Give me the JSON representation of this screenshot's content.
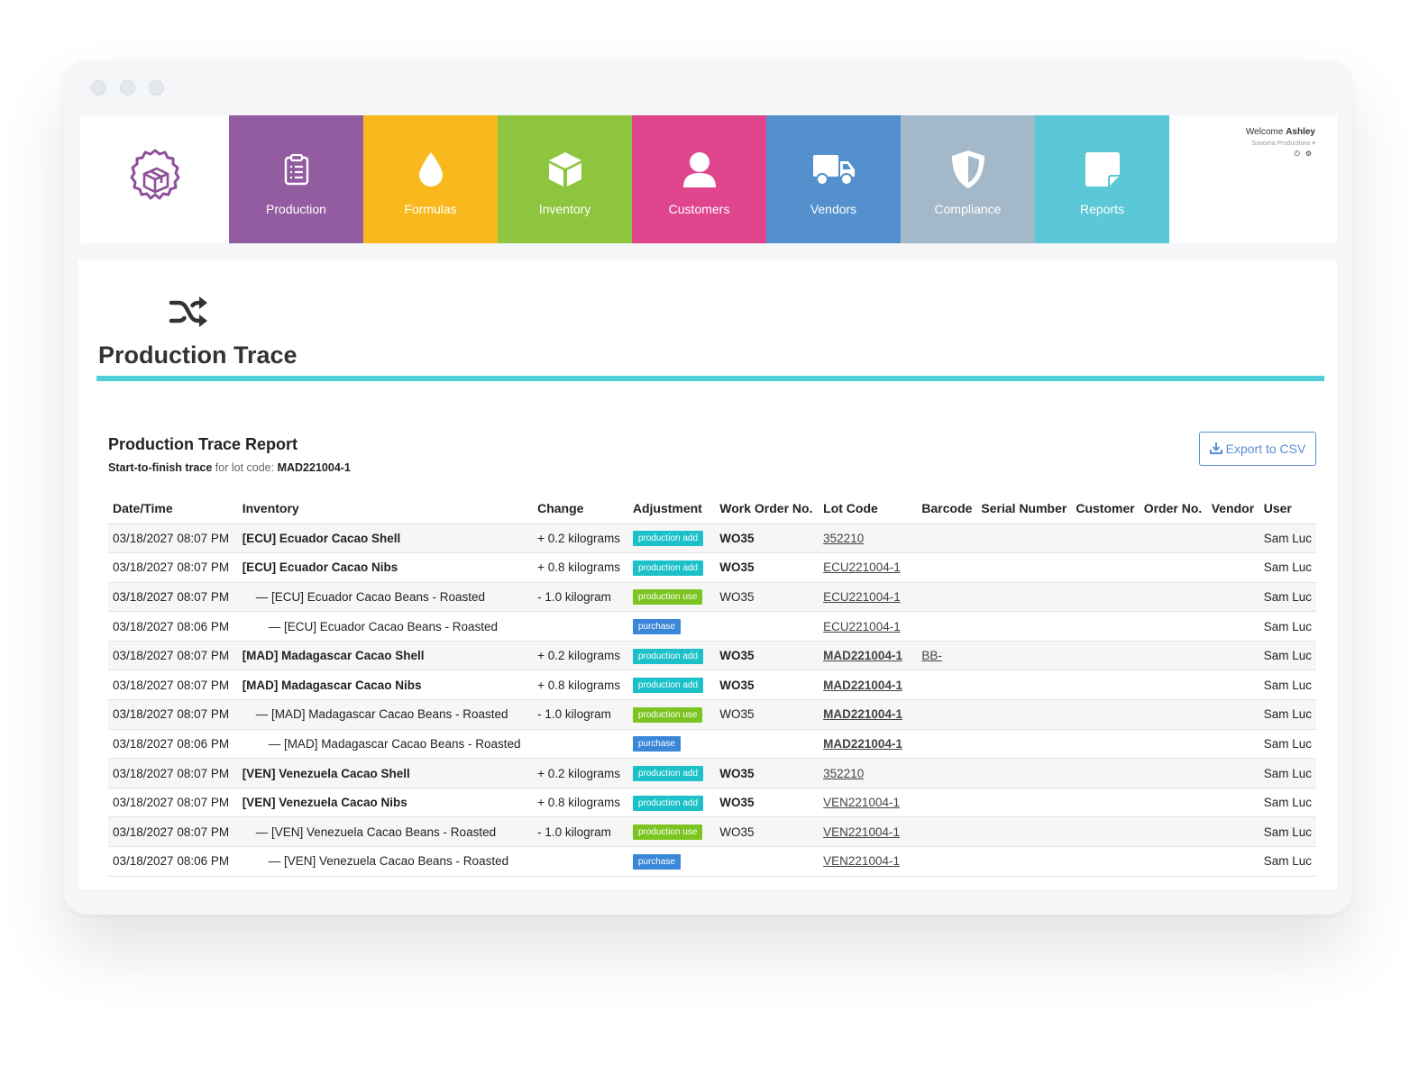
{
  "nav": {
    "tiles": [
      {
        "label": "Production",
        "color": "#935ba0"
      },
      {
        "label": "Formulas",
        "color": "#f9b91c"
      },
      {
        "label": "Inventory",
        "color": "#8dc53e"
      },
      {
        "label": "Customers",
        "color": "#de458d"
      },
      {
        "label": "Vendors",
        "color": "#5490cd"
      },
      {
        "label": "Compliance",
        "color": "#a3b8c9"
      },
      {
        "label": "Reports",
        "color": "#5ac8d6"
      }
    ],
    "welcome_prefix": "Welcome",
    "user_name": "Ashley",
    "company": "Sonoma Productions",
    "logo_color": "#8e4e9a"
  },
  "page": {
    "title": "Production Trace"
  },
  "report": {
    "title": "Production Trace Report",
    "subtitle_bold": "Start-to-finish trace",
    "subtitle_text": "for lot code:",
    "lot_code": "MAD221004-1",
    "export_label": "Export to CSV"
  },
  "table": {
    "headers": [
      "Date/Time",
      "Inventory",
      "Change",
      "Adjustment",
      "Work Order No.",
      "Lot Code",
      "Barcode",
      "Serial Number",
      "Customer",
      "Order No.",
      "Vendor",
      "User"
    ],
    "rows": [
      {
        "datetime": "03/18/2027 08:07 PM",
        "inventory": "[ECU] Ecuador Cacao Shell",
        "level": 0,
        "change": "+ 0.2 kilograms",
        "adjustment": "production add",
        "work_order": "WO35",
        "wo_bold": true,
        "lot_code": "352210",
        "lot_bold": false,
        "barcode": "",
        "serial": "",
        "customer": "",
        "order_no": "",
        "vendor": "",
        "user": "Sam Luc"
      },
      {
        "datetime": "03/18/2027 08:07 PM",
        "inventory": "[ECU] Ecuador Cacao Nibs",
        "level": 0,
        "change": "+ 0.8 kilograms",
        "adjustment": "production add",
        "work_order": "WO35",
        "wo_bold": true,
        "lot_code": "ECU221004-1",
        "lot_bold": false,
        "barcode": "",
        "serial": "",
        "customer": "",
        "order_no": "",
        "vendor": "",
        "user": "Sam Luc"
      },
      {
        "datetime": "03/18/2027 08:07 PM",
        "inventory": "— [ECU] Ecuador Cacao Beans - Roasted",
        "level": 1,
        "change": "- 1.0 kilogram",
        "adjustment": "production use",
        "work_order": "WO35",
        "wo_bold": false,
        "lot_code": "ECU221004-1",
        "lot_bold": false,
        "barcode": "",
        "serial": "",
        "customer": "",
        "order_no": "",
        "vendor": "",
        "user": "Sam Luc"
      },
      {
        "datetime": "03/18/2027 08:06 PM",
        "inventory": "— [ECU] Ecuador Cacao Beans - Roasted",
        "level": 2,
        "change": "",
        "adjustment": "purchase",
        "work_order": "",
        "wo_bold": false,
        "lot_code": "ECU221004-1",
        "lot_bold": false,
        "barcode": "",
        "serial": "",
        "customer": "",
        "order_no": "",
        "vendor": "",
        "user": "Sam Luc"
      },
      {
        "datetime": "03/18/2027 08:07 PM",
        "inventory": "[MAD] Madagascar Cacao Shell",
        "level": 0,
        "change": "+ 0.2 kilograms",
        "adjustment": "production add",
        "work_order": "WO35",
        "wo_bold": true,
        "lot_code": "MAD221004-1",
        "lot_bold": true,
        "barcode": "BB-",
        "serial": "",
        "customer": "",
        "order_no": "",
        "vendor": "",
        "user": "Sam Luc"
      },
      {
        "datetime": "03/18/2027 08:07 PM",
        "inventory": "[MAD] Madagascar Cacao Nibs",
        "level": 0,
        "change": "+ 0.8 kilograms",
        "adjustment": "production add",
        "work_order": "WO35",
        "wo_bold": true,
        "lot_code": "MAD221004-1",
        "lot_bold": true,
        "barcode": "",
        "serial": "",
        "customer": "",
        "order_no": "",
        "vendor": "",
        "user": "Sam Luc"
      },
      {
        "datetime": "03/18/2027 08:07 PM",
        "inventory": "— [MAD] Madagascar Cacao Beans - Roasted",
        "level": 1,
        "change": "- 1.0 kilogram",
        "adjustment": "production use",
        "work_order": "WO35",
        "wo_bold": false,
        "lot_code": "MAD221004-1",
        "lot_bold": true,
        "barcode": "",
        "serial": "",
        "customer": "",
        "order_no": "",
        "vendor": "",
        "user": "Sam Luc"
      },
      {
        "datetime": "03/18/2027 08:06 PM",
        "inventory": "— [MAD] Madagascar Cacao Beans - Roasted",
        "level": 2,
        "change": "",
        "adjustment": "purchase",
        "work_order": "",
        "wo_bold": false,
        "lot_code": "MAD221004-1",
        "lot_bold": true,
        "barcode": "",
        "serial": "",
        "customer": "",
        "order_no": "",
        "vendor": "",
        "user": "Sam Luc"
      },
      {
        "datetime": "03/18/2027 08:07 PM",
        "inventory": "[VEN] Venezuela Cacao Shell",
        "level": 0,
        "change": "+ 0.2 kilograms",
        "adjustment": "production add",
        "work_order": "WO35",
        "wo_bold": true,
        "lot_code": "352210",
        "lot_bold": false,
        "barcode": "",
        "serial": "",
        "customer": "",
        "order_no": "",
        "vendor": "",
        "user": "Sam Luc"
      },
      {
        "datetime": "03/18/2027 08:07 PM",
        "inventory": "[VEN] Venezuela Cacao Nibs",
        "level": 0,
        "change": "+ 0.8 kilograms",
        "adjustment": "production add",
        "work_order": "WO35",
        "wo_bold": true,
        "lot_code": "VEN221004-1",
        "lot_bold": false,
        "barcode": "",
        "serial": "",
        "customer": "",
        "order_no": "",
        "vendor": "",
        "user": "Sam Luc"
      },
      {
        "datetime": "03/18/2027 08:07 PM",
        "inventory": "— [VEN] Venezuela Cacao Beans - Roasted",
        "level": 1,
        "change": "- 1.0 kilogram",
        "adjustment": "production use",
        "work_order": "WO35",
        "wo_bold": false,
        "lot_code": "VEN221004-1",
        "lot_bold": false,
        "barcode": "",
        "serial": "",
        "customer": "",
        "order_no": "",
        "vendor": "",
        "user": "Sam Luc"
      },
      {
        "datetime": "03/18/2027 08:06 PM",
        "inventory": "— [VEN] Venezuela Cacao Beans - Roasted",
        "level": 2,
        "change": "",
        "adjustment": "purchase",
        "work_order": "",
        "wo_bold": false,
        "lot_code": "VEN221004-1",
        "lot_bold": false,
        "barcode": "",
        "serial": "",
        "customer": "",
        "order_no": "",
        "vendor": "",
        "user": "Sam Luc"
      }
    ]
  },
  "icons": {
    "nav": [
      "clipboard-icon",
      "droplet-icon",
      "box-icon",
      "user-icon",
      "truck-icon",
      "shield-icon",
      "note-icon"
    ],
    "page": "shuffle-icon",
    "export": "download-icon"
  }
}
